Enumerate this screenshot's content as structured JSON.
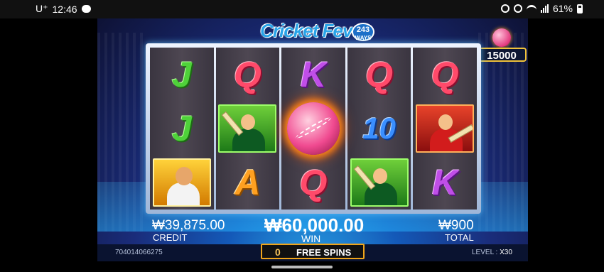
{
  "status_bar": {
    "carrier": "U⁺",
    "time": "12:46",
    "battery": "61%"
  },
  "game": {
    "logo_text": "Cricket Fever",
    "logo_ways_num": "243",
    "logo_ways_label": "WAYS",
    "jackpot_value": "15000",
    "reels": [
      [
        "J",
        "J",
        "gold-player"
      ],
      [
        "Q",
        "batsman",
        "A"
      ],
      [
        "K",
        "fireball",
        "Q"
      ],
      [
        "Q",
        "10",
        "batsman"
      ],
      [
        "Q",
        "red-player",
        "K"
      ]
    ],
    "credit_value": "₩39,875.00",
    "credit_label": "CREDIT",
    "win_value": "₩60,000.00",
    "win_label": "WIN",
    "total_value": "₩900",
    "total_label": "TOTAL",
    "transaction_id": "704014066275",
    "free_spins_count": "0",
    "free_spins_label": "FREE SPINS",
    "level_label": "LEVEL :",
    "level_value": "X30"
  },
  "colors": {
    "letter_J": "#4fd23a",
    "letter_Q": "#ff4a6a",
    "letter_K": "#c04ee8",
    "letter_10": "#3a8fff",
    "letter_A": "#ffa020",
    "accent_gold": "#f0a51a"
  }
}
